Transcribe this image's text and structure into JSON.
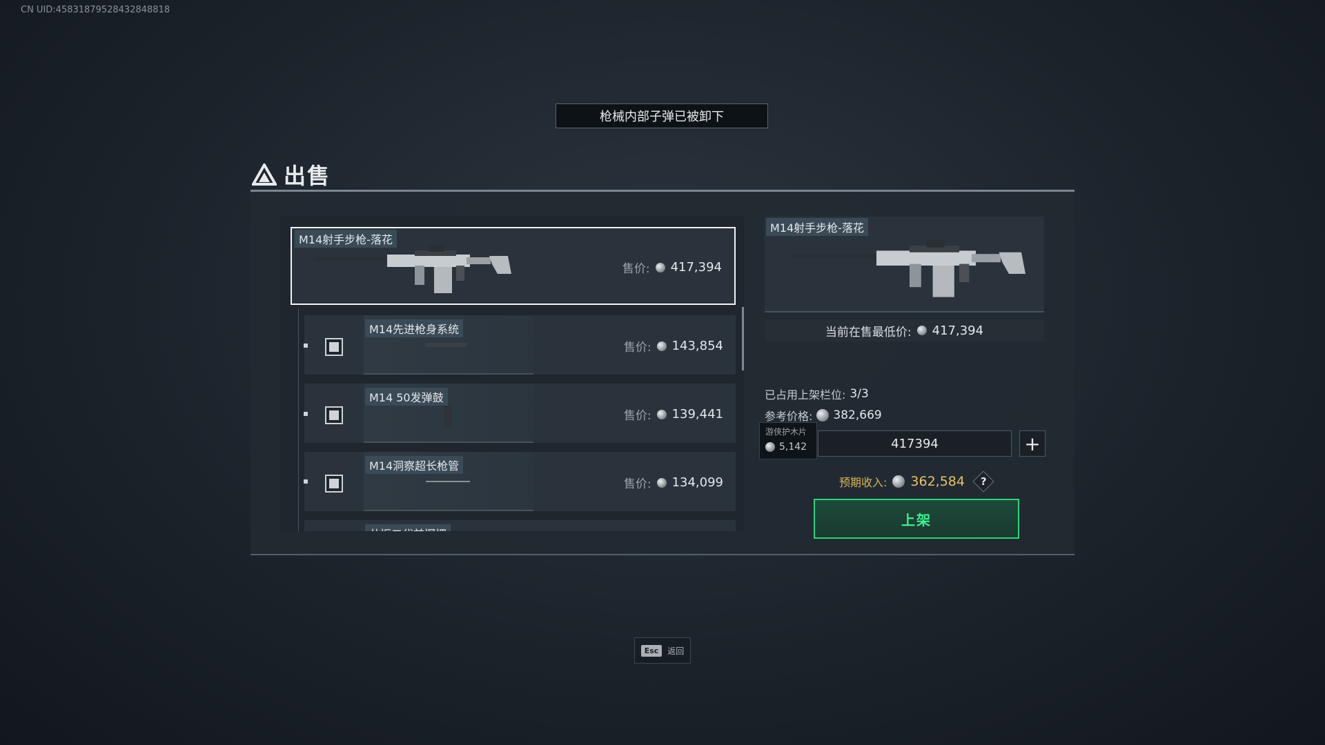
{
  "uid": "CN UID:4583187952843284881​8",
  "toast": "枪械内部子弹已被卸下",
  "page_title": "出售",
  "main_item": {
    "name": "M14射手步枪-落花",
    "price_label": "售价:",
    "price": "417,394"
  },
  "sub_items": [
    {
      "name": "M14先进枪身系统",
      "price_label": "售价:",
      "price": "143,854"
    },
    {
      "name": "M14 50发弹鼓",
      "price_label": "售价:",
      "price": "139,441"
    },
    {
      "name": "M14洞察超长枪管",
      "price_label": "售价:",
      "price": "134,099"
    },
    {
      "name": "共振二代前握把",
      "price_label": "售价:",
      "price": ""
    }
  ],
  "detail": {
    "name": "M14射手步枪-落花",
    "lowest_label": "当前在售最低价:",
    "lowest_price": "417,394",
    "slots_label": "已占用上架栏位:",
    "slots_value": "3/3",
    "ref_label": "参考价格:",
    "ref_price": "382,669",
    "tooltip_title": "游侠护木片",
    "tooltip_value": "5,142",
    "input_value": "417394",
    "expected_label": "预期收入:",
    "expected_value": "362,584",
    "help": "?",
    "list_button": "上架"
  },
  "footer": {
    "esc_key": "Esc",
    "esc_label": "返回"
  },
  "colors": {
    "accent_green": "#2fd37a",
    "income_gold": "#e7c36a"
  }
}
